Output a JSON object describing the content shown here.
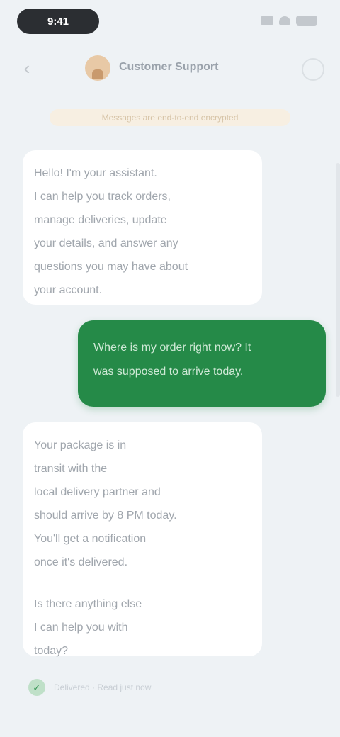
{
  "status_bar": {
    "time": "9:41",
    "icons": [
      "signal-icon",
      "wifi-icon",
      "battery-icon"
    ]
  },
  "header": {
    "contact_name": "Customer Support",
    "back_icon": "chevron-left-icon",
    "menu_icon": "more-icon"
  },
  "banner": {
    "text": "Messages are end-to-end encrypted"
  },
  "messages": [
    {
      "direction": "incoming",
      "lines": [
        "Hello! I'm your assistant.",
        "I can help you track orders,",
        "manage deliveries, update",
        "your details, and answer any",
        "questions you may have about",
        "your account."
      ]
    },
    {
      "direction": "outgoing",
      "lines": [
        "Where is my order right now? It",
        "was supposed to arrive today."
      ]
    },
    {
      "direction": "incoming",
      "paragraphs": [
        [
          "Your package is in",
          "transit with the",
          "local delivery partner and",
          "should arrive by 8 PM today.",
          "You'll get a notification",
          "once it's delivered."
        ],
        [
          "Is there anything else",
          "I can help you with",
          "today?"
        ]
      ]
    }
  ],
  "footer": {
    "text": "Delivered · Read just now",
    "icon": "check-icon"
  },
  "colors": {
    "background": "#eef2f5",
    "outgoing_bubble": "#258a48",
    "incoming_bubble": "#ffffff",
    "banner": "#f7efe2"
  }
}
